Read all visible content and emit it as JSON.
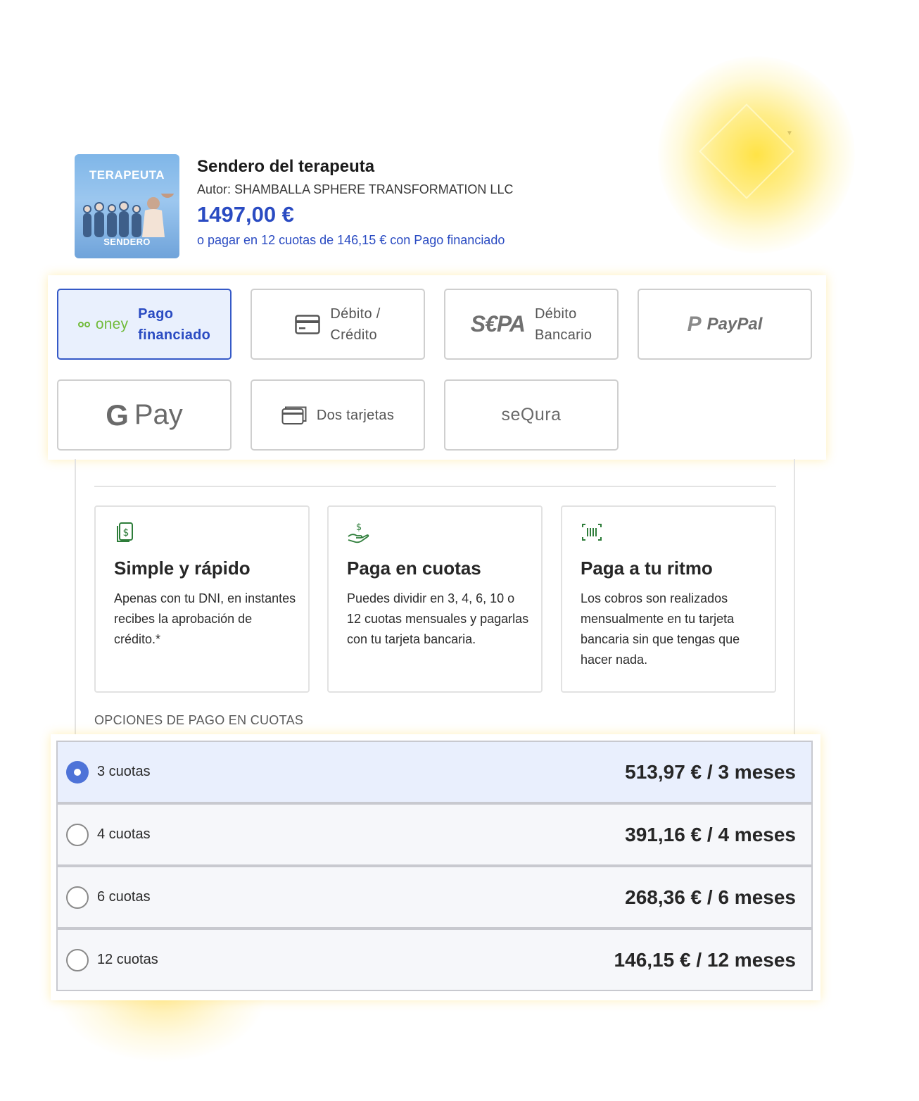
{
  "product": {
    "thumbnail_title": "TERAPEUTA",
    "thumbnail_subtitle": "SENDERO",
    "title": "Sendero del terapeuta",
    "author": "Autor: SHAMBALLA SPHERE TRANSFORMATION LLC",
    "price": "1497,00 €",
    "financing_text": "o pagar en 12 cuotas de 146,15 € con Pago financiado"
  },
  "payment_methods": [
    {
      "id": "oney",
      "logo_text": "oney",
      "label_line1": "Pago",
      "label_line2": "financiado",
      "selected": true
    },
    {
      "id": "card",
      "icon": "credit-card-icon",
      "label_line1": "Débito /",
      "label_line2": "Crédito",
      "selected": false
    },
    {
      "id": "sepa",
      "logo_text": "S€PA",
      "label_line1": "Débito",
      "label_line2": "Bancario",
      "selected": false
    },
    {
      "id": "paypal",
      "logo_text": "PayPal",
      "selected": false
    },
    {
      "id": "gpay",
      "logo_g": "G",
      "logo_text": "Pay",
      "selected": false
    },
    {
      "id": "two-cards",
      "icon": "two-cards-icon",
      "label": "Dos tarjetas",
      "selected": false
    },
    {
      "id": "sequra",
      "logo_text": "seQura",
      "selected": false
    }
  ],
  "features": [
    {
      "icon": "money-document-icon",
      "title": "Simple y rápido",
      "description": "Apenas con tu DNI, en instantes recibes la aprobación de crédito.*"
    },
    {
      "icon": "hand-money-icon",
      "title": "Paga en cuotas",
      "description": "Puedes dividir en 3, 4, 6, 10 o 12 cuotas mensuales y pagarlas con tu tarjeta bancaria."
    },
    {
      "icon": "barcode-scan-icon",
      "title": "Paga a tu ritmo",
      "description": "Los cobros son realizados mensualmente en tu tarjeta bancaria sin que tengas que hacer nada."
    }
  ],
  "installments": {
    "section_label": "OPCIONES DE PAGO EN CUOTAS",
    "options": [
      {
        "label": "3 cuotas",
        "amount": "513,97 € / 3 meses",
        "selected": true
      },
      {
        "label": "4 cuotas",
        "amount": "391,16 € / 4 meses",
        "selected": false
      },
      {
        "label": "6 cuotas",
        "amount": "268,36 € / 6 meses",
        "selected": false
      },
      {
        "label": "12 cuotas",
        "amount": "146,15 € / 12 meses",
        "selected": false
      }
    ]
  },
  "colors": {
    "accent_blue": "#2a4bc2",
    "selected_bg": "#e9f0fd",
    "radio_selected": "#4e73d8",
    "oney_green": "#71bb3a",
    "icon_green": "#2e7d3a",
    "glow_yellow": "#ffe13c"
  }
}
